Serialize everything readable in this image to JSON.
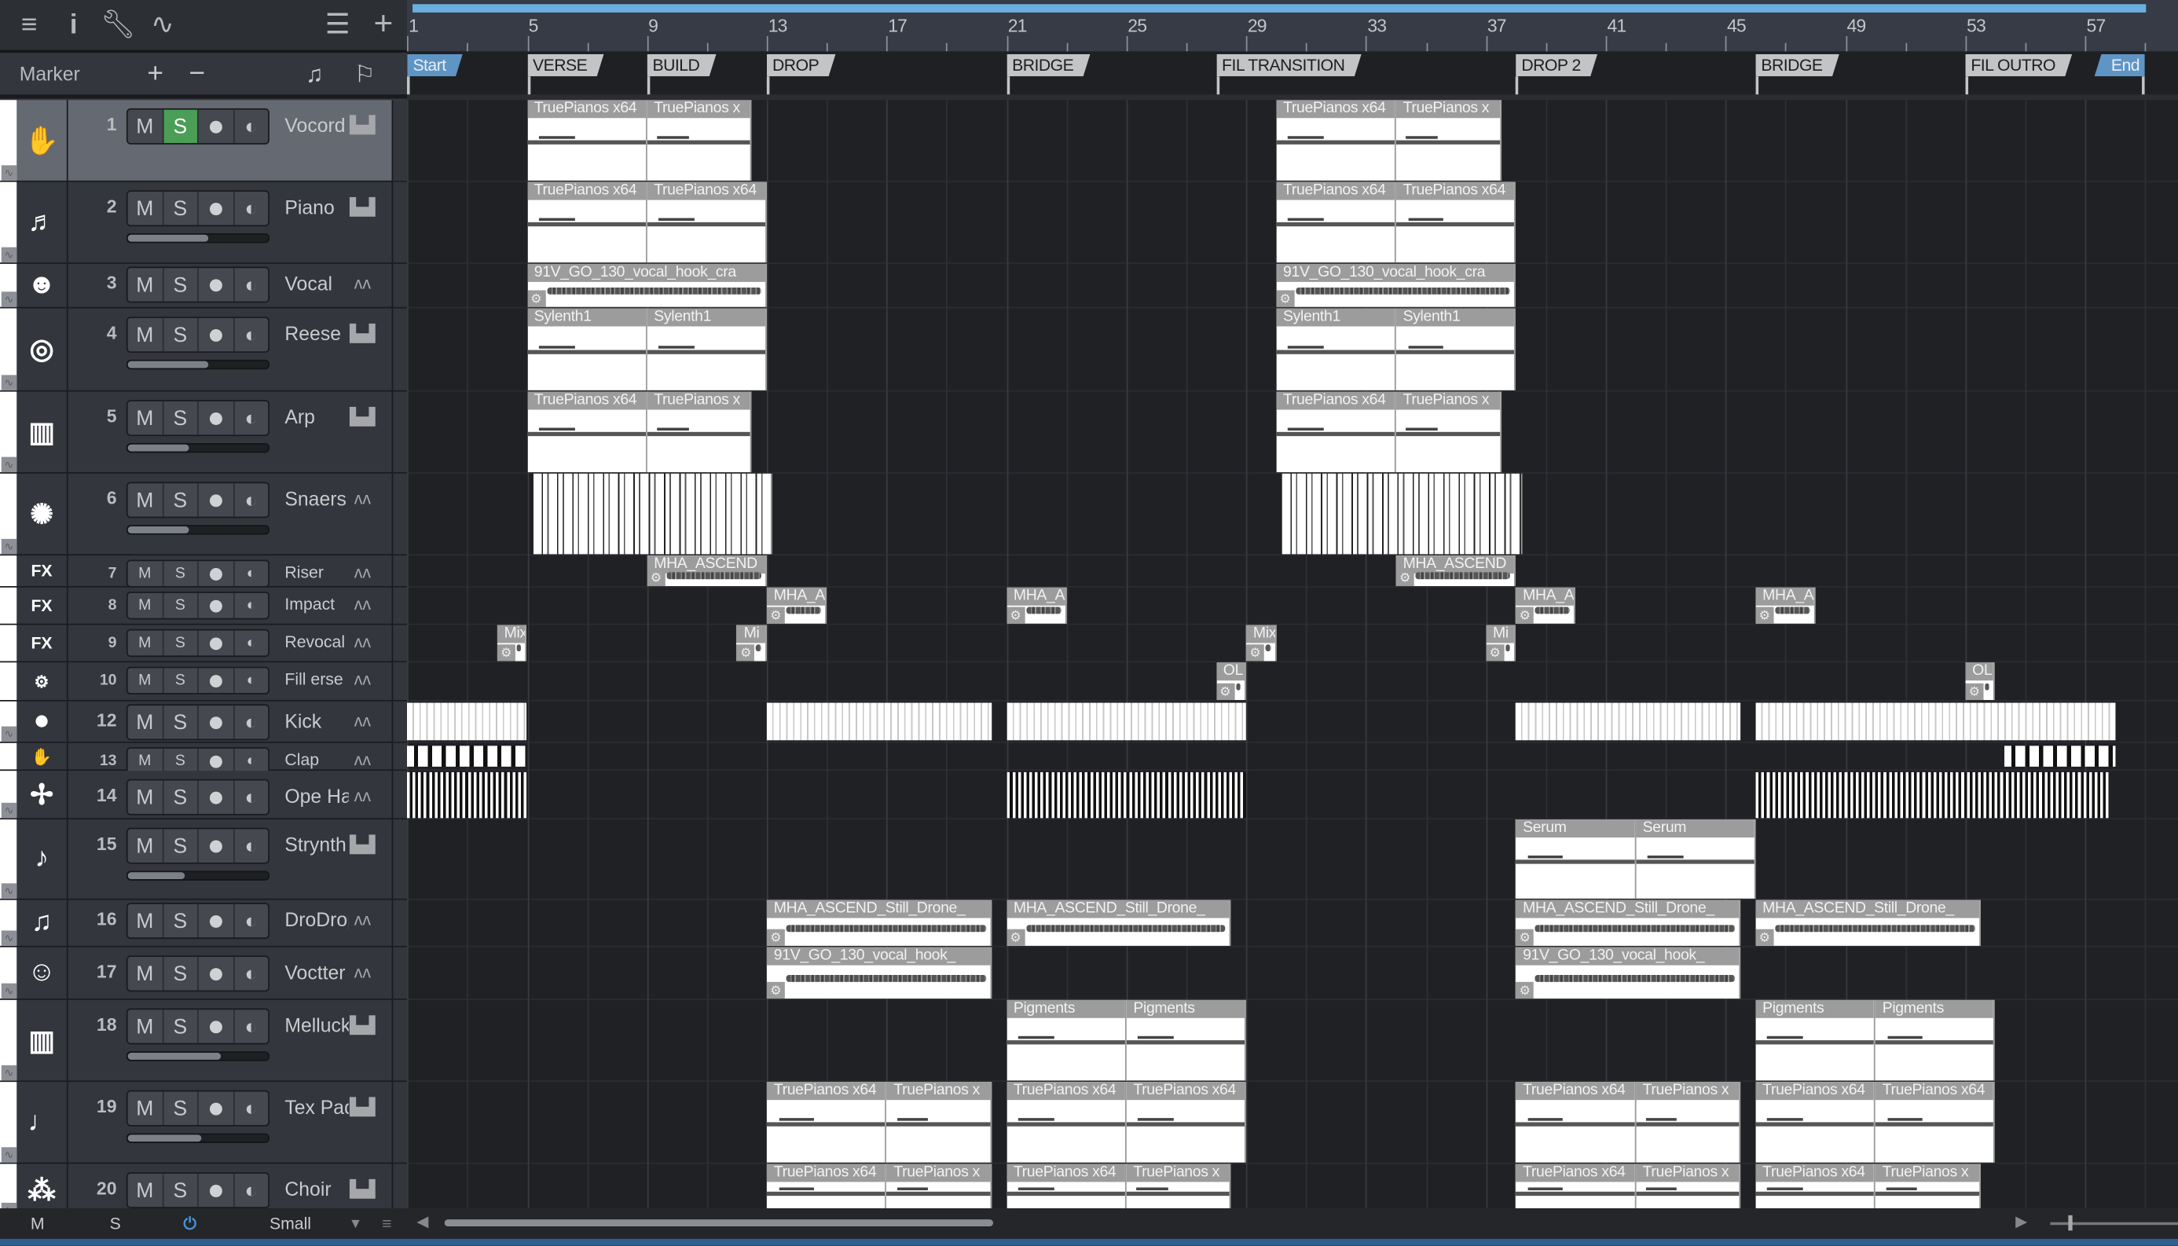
{
  "toolbar": {
    "icons": [
      "menu-icon",
      "info-icon",
      "wrench-icon",
      "automation-icon",
      "list-icon",
      "add-track-icon"
    ]
  },
  "marker_bar": {
    "label": "Marker",
    "add": "+",
    "remove": "−"
  },
  "ruler": {
    "bar_labels": [
      "1",
      "5",
      "9",
      "13",
      "17",
      "21",
      "25",
      "29",
      "33",
      "37",
      "41",
      "45",
      "49",
      "53",
      "57"
    ]
  },
  "markers": [
    {
      "label": "Start",
      "bar": 1,
      "color": "blue"
    },
    {
      "label": "VERSE",
      "bar": 5
    },
    {
      "label": "BUILD",
      "bar": 9
    },
    {
      "label": "DROP",
      "bar": 13
    },
    {
      "label": "BRIDGE",
      "bar": 21
    },
    {
      "label": "FIL TRANSITION",
      "bar": 28
    },
    {
      "label": "DROP 2",
      "bar": 38
    },
    {
      "label": "BRIDGE",
      "bar": 46
    },
    {
      "label": "FIL OUTRO",
      "bar": 53
    },
    {
      "label": "End",
      "bar": 59,
      "color": "blue"
    }
  ],
  "tracks": [
    {
      "num": "1",
      "name": "Vocord",
      "type": "instrument",
      "icon": "thumbs-up-icon",
      "solo": true,
      "selected": true
    },
    {
      "num": "2",
      "name": "Piano",
      "type": "instrument",
      "icon": "grand-piano-icon",
      "volume": 0.57
    },
    {
      "num": "3",
      "name": "Vocal",
      "type": "audio",
      "icon": "singer-icon"
    },
    {
      "num": "4",
      "name": "Reese",
      "type": "instrument",
      "icon": "speaker-icon",
      "volume": 0.57
    },
    {
      "num": "5",
      "name": "Arp",
      "type": "instrument",
      "icon": "keyboard-icon",
      "volume": 0.44
    },
    {
      "num": "6",
      "name": "Snaers",
      "type": "audio",
      "icon": "drum-icon",
      "volume": 0.44
    },
    {
      "num": "7",
      "name": "Riser",
      "type": "audio",
      "icon": "fx-icon",
      "label": "FX"
    },
    {
      "num": "8",
      "name": "Impact",
      "type": "audio",
      "icon": "fx-icon",
      "label": "FX"
    },
    {
      "num": "9",
      "name": "Revocal",
      "type": "audio",
      "icon": "fx-icon",
      "label": "FX"
    },
    {
      "num": "10",
      "name": "Fill erse",
      "type": "audio",
      "icon": "drumkit-icon"
    },
    {
      "num": "12",
      "name": "Kick",
      "type": "audio",
      "icon": "kick-icon"
    },
    {
      "num": "13",
      "name": "Clap",
      "type": "audio",
      "icon": "hand-icon"
    },
    {
      "num": "14",
      "name": "Ope Ha",
      "type": "audio",
      "icon": "hihat-icon"
    },
    {
      "num": "15",
      "name": "Strynth",
      "type": "instrument",
      "icon": "violin-icon",
      "volume": 0.41
    },
    {
      "num": "16",
      "name": "DroDrop",
      "type": "audio",
      "icon": "strings-icon"
    },
    {
      "num": "17",
      "name": "Voctter",
      "type": "audio",
      "icon": "smiley-icon"
    },
    {
      "num": "18",
      "name": "Melluck",
      "type": "instrument",
      "icon": "piano-keys-icon",
      "volume": 0.66
    },
    {
      "num": "19",
      "name": "Tex Pad",
      "type": "instrument",
      "icon": "tuba-icon",
      "volume": 0.52
    },
    {
      "num": "20",
      "name": "Choir",
      "type": "instrument",
      "icon": "choir-icon"
    }
  ],
  "clips": [
    {
      "t": 0,
      "s": 5,
      "e": 9,
      "label": "TruePianos x64",
      "kind": "midi"
    },
    {
      "t": 0,
      "s": 9,
      "e": 12.5,
      "label": "TruePianos x",
      "kind": "midi"
    },
    {
      "t": 0,
      "s": 30,
      "e": 34,
      "label": "TruePianos x64",
      "kind": "midi"
    },
    {
      "t": 0,
      "s": 34,
      "e": 37.5,
      "label": "TruePianos x",
      "kind": "midi"
    },
    {
      "t": 1,
      "s": 5,
      "e": 9,
      "label": "TruePianos x64",
      "kind": "midi"
    },
    {
      "t": 1,
      "s": 9,
      "e": 13,
      "label": "TruePianos x64",
      "kind": "midi"
    },
    {
      "t": 1,
      "s": 30,
      "e": 34,
      "label": "TruePianos x64",
      "kind": "midi"
    },
    {
      "t": 1,
      "s": 34,
      "e": 38,
      "label": "TruePianos x64",
      "kind": "midi"
    },
    {
      "t": 2,
      "s": 5,
      "e": 13,
      "label": "91V_GO_130_vocal_hook_cra",
      "kind": "audio"
    },
    {
      "t": 2,
      "s": 30,
      "e": 38,
      "label": "91V_GO_130_vocal_hook_cra",
      "kind": "audio"
    },
    {
      "t": 3,
      "s": 5,
      "e": 9,
      "label": "Sylenth1",
      "kind": "midi"
    },
    {
      "t": 3,
      "s": 9,
      "e": 13,
      "label": "Sylenth1",
      "kind": "midi"
    },
    {
      "t": 3,
      "s": 30,
      "e": 34,
      "label": "Sylenth1",
      "kind": "midi"
    },
    {
      "t": 3,
      "s": 34,
      "e": 38,
      "label": "Sylenth1",
      "kind": "midi"
    },
    {
      "t": 4,
      "s": 5,
      "e": 9,
      "label": "TruePianos x64",
      "kind": "midi"
    },
    {
      "t": 4,
      "s": 9,
      "e": 12.5,
      "label": "TruePianos x",
      "kind": "midi"
    },
    {
      "t": 4,
      "s": 30,
      "e": 34,
      "label": "TruePianos x64",
      "kind": "midi"
    },
    {
      "t": 4,
      "s": 34,
      "e": 37.5,
      "label": "TruePianos x",
      "kind": "midi"
    },
    {
      "t": 5,
      "s": 5.2,
      "e": 13.2,
      "kind": "drum"
    },
    {
      "t": 5,
      "s": 30.2,
      "e": 38.2,
      "kind": "drum"
    },
    {
      "t": 6,
      "s": 9,
      "e": 13,
      "label": "MHA_ASCEND",
      "kind": "audio"
    },
    {
      "t": 6,
      "s": 34,
      "e": 38,
      "label": "MHA_ASCEND",
      "kind": "audio"
    },
    {
      "t": 7,
      "s": 13,
      "e": 15,
      "label": "MHA_A",
      "kind": "audio"
    },
    {
      "t": 7,
      "s": 21,
      "e": 23,
      "label": "MHA_A",
      "kind": "audio"
    },
    {
      "t": 7,
      "s": 38,
      "e": 40,
      "label": "MHA_A",
      "kind": "audio"
    },
    {
      "t": 7,
      "s": 46,
      "e": 48,
      "label": "MHA_A",
      "kind": "audio"
    },
    {
      "t": 8,
      "s": 4,
      "e": 5,
      "label": "Mix",
      "kind": "audio"
    },
    {
      "t": 8,
      "s": 12,
      "e": 13,
      "label": "Mi",
      "kind": "audio"
    },
    {
      "t": 8,
      "s": 29,
      "e": 30,
      "label": "Mix",
      "kind": "audio"
    },
    {
      "t": 8,
      "s": 37,
      "e": 38,
      "label": "Mi",
      "kind": "audio"
    },
    {
      "t": 9,
      "s": 28,
      "e": 29,
      "label": "OL",
      "kind": "audio"
    },
    {
      "t": 9,
      "s": 53,
      "e": 54,
      "label": "OL",
      "kind": "audio"
    },
    {
      "t": 10,
      "s": 1,
      "e": 5,
      "kind": "kick"
    },
    {
      "t": 10,
      "s": 13,
      "e": 20.5,
      "kind": "kick"
    },
    {
      "t": 10,
      "s": 21,
      "e": 29,
      "kind": "kick"
    },
    {
      "t": 10,
      "s": 38,
      "e": 45.5,
      "kind": "kick"
    },
    {
      "t": 10,
      "s": 46,
      "e": 58,
      "kind": "kick"
    },
    {
      "t": 11,
      "s": 1,
      "e": 5,
      "kind": "clap"
    },
    {
      "t": 11,
      "s": 54.3,
      "e": 58,
      "kind": "clap"
    },
    {
      "t": 12,
      "s": 1,
      "e": 5,
      "kind": "hat"
    },
    {
      "t": 12,
      "s": 21,
      "e": 29,
      "kind": "hat"
    },
    {
      "t": 12,
      "s": 46,
      "e": 57.8,
      "kind": "hat"
    },
    {
      "t": 13,
      "s": 38,
      "e": 42,
      "label": "Serum",
      "kind": "midi"
    },
    {
      "t": 13,
      "s": 42,
      "e": 46,
      "label": "Serum",
      "kind": "midi"
    },
    {
      "t": 14,
      "s": 13,
      "e": 20.5,
      "label": "MHA_ASCEND_Still_Drone_",
      "kind": "audio"
    },
    {
      "t": 14,
      "s": 21,
      "e": 28.5,
      "label": "MHA_ASCEND_Still_Drone_",
      "kind": "audio"
    },
    {
      "t": 14,
      "s": 38,
      "e": 45.5,
      "label": "MHA_ASCEND_Still_Drone_",
      "kind": "audio"
    },
    {
      "t": 14,
      "s": 46,
      "e": 53.5,
      "label": "MHA_ASCEND_Still_Drone_",
      "kind": "audio"
    },
    {
      "t": 15,
      "s": 13,
      "e": 20.5,
      "label": "91V_GO_130_vocal_hook_",
      "kind": "audio"
    },
    {
      "t": 15,
      "s": 38,
      "e": 45.5,
      "label": "91V_GO_130_vocal_hook_",
      "kind": "audio"
    },
    {
      "t": 16,
      "s": 21,
      "e": 25,
      "label": "Pigments",
      "kind": "midi"
    },
    {
      "t": 16,
      "s": 25,
      "e": 29,
      "label": "Pigments",
      "kind": "midi"
    },
    {
      "t": 16,
      "s": 46,
      "e": 50,
      "label": "Pigments",
      "kind": "midi"
    },
    {
      "t": 16,
      "s": 50,
      "e": 54,
      "label": "Pigments",
      "kind": "midi"
    },
    {
      "t": 17,
      "s": 13,
      "e": 17,
      "label": "TruePianos x64",
      "kind": "midi"
    },
    {
      "t": 17,
      "s": 17,
      "e": 20.5,
      "label": "TruePianos x",
      "kind": "midi"
    },
    {
      "t": 17,
      "s": 21,
      "e": 25,
      "label": "TruePianos x64",
      "kind": "midi"
    },
    {
      "t": 17,
      "s": 25,
      "e": 29,
      "label": "TruePianos x64",
      "kind": "midi"
    },
    {
      "t": 17,
      "s": 38,
      "e": 42,
      "label": "TruePianos x64",
      "kind": "midi"
    },
    {
      "t": 17,
      "s": 42,
      "e": 45.5,
      "label": "TruePianos x",
      "kind": "midi"
    },
    {
      "t": 17,
      "s": 46,
      "e": 50,
      "label": "TruePianos x64",
      "kind": "midi"
    },
    {
      "t": 17,
      "s": 50,
      "e": 54,
      "label": "TruePianos x64",
      "kind": "midi"
    },
    {
      "t": 18,
      "s": 13,
      "e": 17,
      "label": "TruePianos x64",
      "kind": "midi"
    },
    {
      "t": 18,
      "s": 17,
      "e": 20.5,
      "label": "TruePianos x",
      "kind": "midi"
    },
    {
      "t": 18,
      "s": 21,
      "e": 25,
      "label": "TruePianos x64",
      "kind": "midi"
    },
    {
      "t": 18,
      "s": 25,
      "e": 28.5,
      "label": "TruePianos x",
      "kind": "midi"
    },
    {
      "t": 18,
      "s": 38,
      "e": 42,
      "label": "TruePianos x64",
      "kind": "midi"
    },
    {
      "t": 18,
      "s": 42,
      "e": 45.5,
      "label": "TruePianos x",
      "kind": "midi"
    },
    {
      "t": 18,
      "s": 46,
      "e": 50,
      "label": "TruePianos x64",
      "kind": "midi"
    },
    {
      "t": 18,
      "s": 50,
      "e": 53.5,
      "label": "TruePianos x",
      "kind": "midi"
    }
  ],
  "footer": {
    "mute_all": "M",
    "solo_all": "S",
    "size": "Small"
  },
  "colors": {
    "solo": "#4a9e55",
    "loop": "#6aafe0",
    "power": "#4a90d9"
  }
}
